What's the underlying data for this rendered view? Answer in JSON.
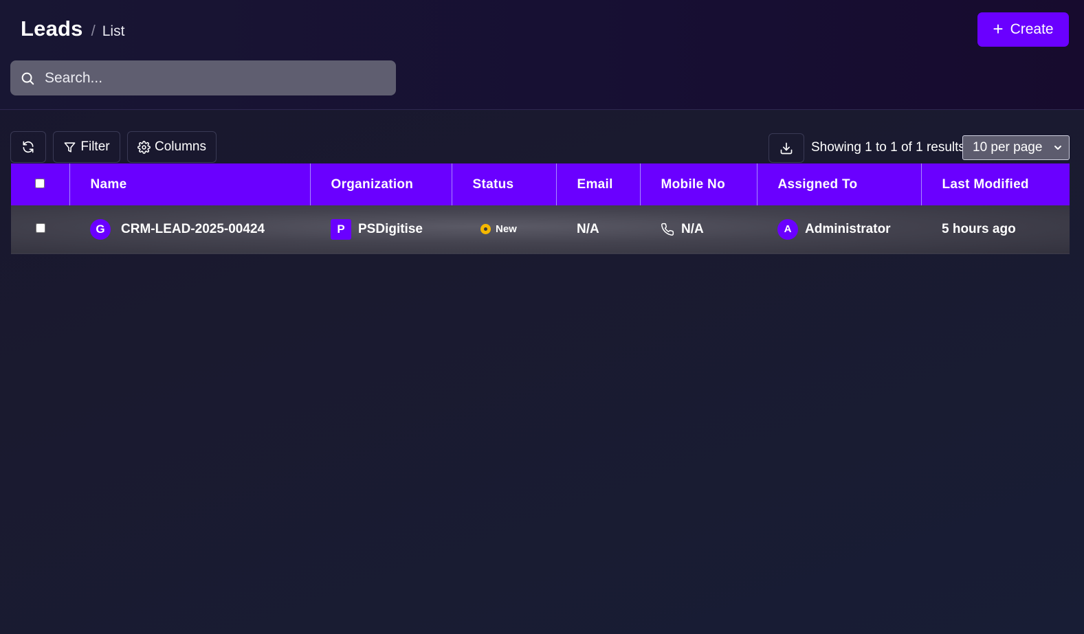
{
  "header": {
    "breadcrumb_main": "Leads",
    "breadcrumb_sep": "/",
    "breadcrumb_sub": "List",
    "create_label": "Create"
  },
  "search": {
    "placeholder": "Search...",
    "value": ""
  },
  "toolbar": {
    "filter_label": "Filter",
    "columns_label": "Columns",
    "results_text": "Showing 1 to 1 of 1 results",
    "per_page": "10 per page"
  },
  "table": {
    "columns": [
      "Name",
      "Organization",
      "Status",
      "Email",
      "Mobile No",
      "Assigned To",
      "Last Modified"
    ],
    "rows": [
      {
        "name_initial": "G",
        "name": "CRM-LEAD-2025-00424",
        "org_initial": "P",
        "organization": "PSDigitise",
        "status": "New",
        "email": "N/A",
        "mobile": "N/A",
        "assigned_initial": "A",
        "assigned_to": "Administrator",
        "last_modified": "5 hours ago"
      }
    ]
  },
  "colors": {
    "accent": "#6a00ff",
    "status_new": "#f5b800",
    "background": "#1a1a2f"
  },
  "icons": [
    "search-icon",
    "plus-icon",
    "refresh-icon",
    "filter-icon",
    "gear-icon",
    "download-icon",
    "chevron-down-icon",
    "phone-icon"
  ]
}
